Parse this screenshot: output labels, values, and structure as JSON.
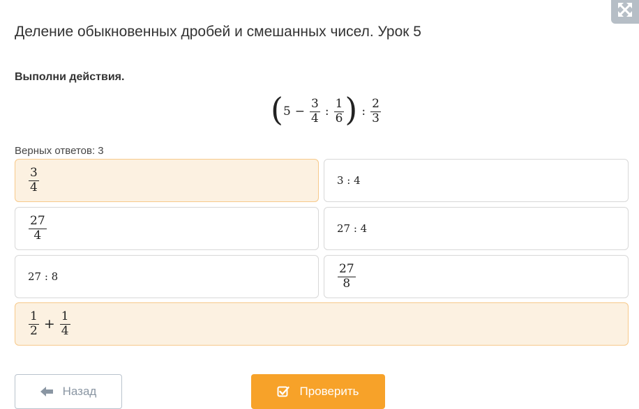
{
  "header": {
    "title": "Деление обыкновенных дробей и смешанных чисел. Урок 5",
    "expand_icon": "expand-arrows-icon"
  },
  "task": {
    "instruction": "Выполни действия.",
    "expression": {
      "whole": "5",
      "minus": "−",
      "f1_num": "3",
      "f1_den": "4",
      "div1": ":",
      "f2_num": "1",
      "f2_den": "6",
      "div2": ":",
      "f3_num": "2",
      "f3_den": "3"
    }
  },
  "answers": {
    "counter": "Верных ответов: 3",
    "options": {
      "opt1": {
        "num": "3",
        "den": "4",
        "selected": true
      },
      "opt2": {
        "text": "3 : 4",
        "selected": false
      },
      "opt3": {
        "num": "27",
        "den": "4",
        "selected": false
      },
      "opt4": {
        "text": "27 : 4",
        "selected": false
      },
      "opt5": {
        "text": "27 : 8",
        "selected": false
      },
      "opt6": {
        "num": "27",
        "den": "8",
        "selected": false
      },
      "opt7": {
        "a_num": "1",
        "a_den": "2",
        "plus": "+",
        "b_num": "1",
        "b_den": "4",
        "selected": true
      }
    }
  },
  "footer": {
    "back_label": "Назад",
    "back_icon": "arrow-left-icon",
    "check_label": "Проверить",
    "check_icon": "checkbox-check-icon"
  },
  "colors": {
    "accent": "#f7a229",
    "selected_bg": "#fcf1e1",
    "selected_border": "#f7c98a"
  }
}
